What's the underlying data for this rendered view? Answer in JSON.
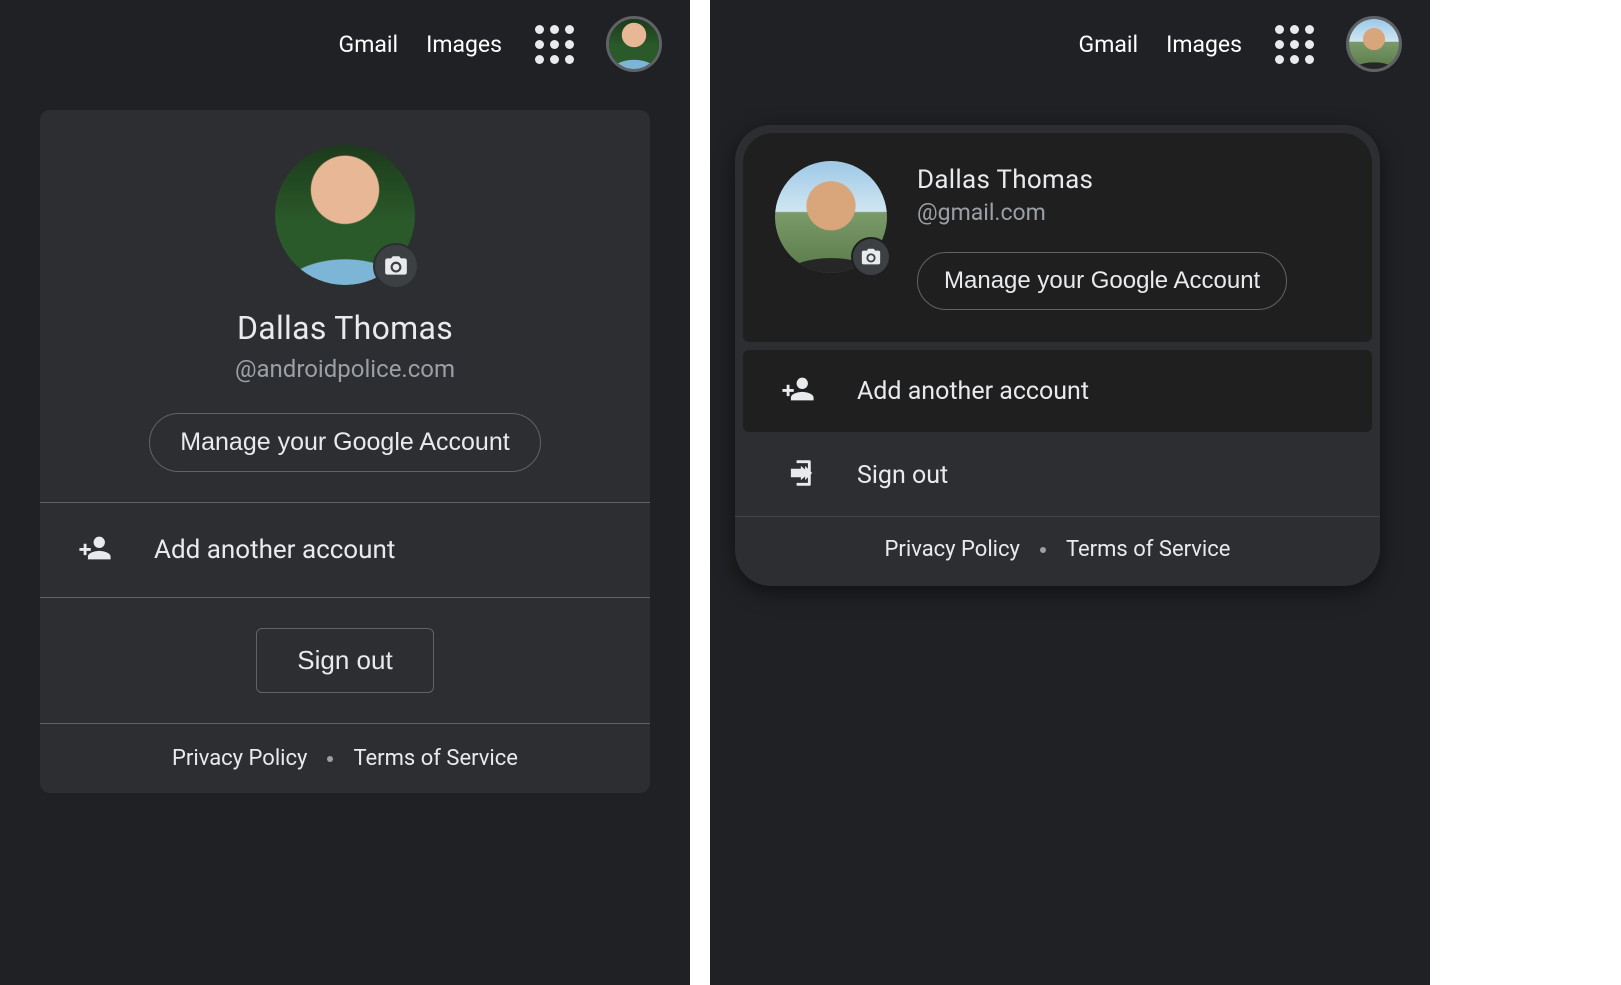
{
  "topbar": {
    "gmail": "Gmail",
    "images": "Images"
  },
  "left": {
    "user_name": "Dallas Thomas",
    "user_email": "@androidpolice.com",
    "manage_label": "Manage your Google Account",
    "add_account_label": "Add another account",
    "sign_out_label": "Sign out",
    "privacy_label": "Privacy Policy",
    "terms_label": "Terms of Service"
  },
  "right": {
    "user_name": "Dallas Thomas",
    "user_email": "@gmail.com",
    "manage_label": "Manage your Google Account",
    "add_account_label": "Add another account",
    "sign_out_label": "Sign out",
    "privacy_label": "Privacy Policy",
    "terms_label": "Terms of Service"
  }
}
